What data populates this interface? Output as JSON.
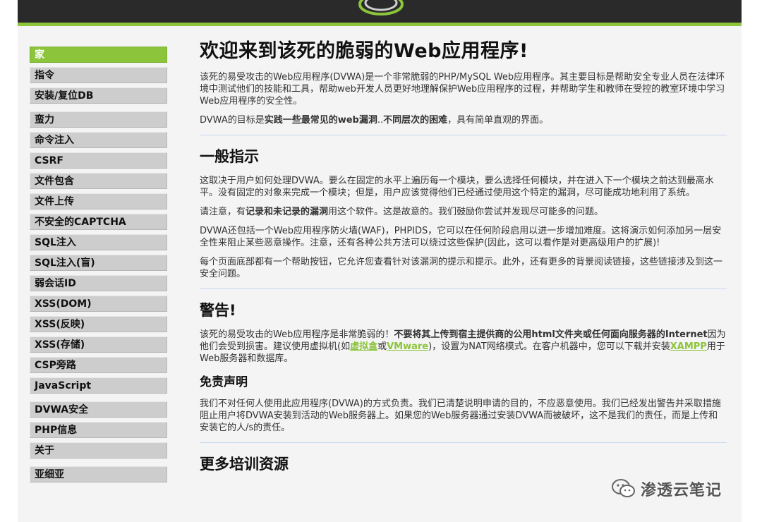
{
  "colors": {
    "accent": "#8cc43c",
    "header_bg": "#2a2a2a",
    "page_bg": "#f4f4f4"
  },
  "menu": {
    "groups": [
      [
        {
          "label": "家",
          "selected": true
        },
        {
          "label": "指令"
        },
        {
          "label": "安装/复位DB"
        }
      ],
      [
        {
          "label": "蛮力"
        },
        {
          "label": "命令注入"
        },
        {
          "label": "CSRF"
        },
        {
          "label": "文件包含"
        },
        {
          "label": "文件上传"
        },
        {
          "label": "不安全的CAPTCHA"
        },
        {
          "label": "SQL注入"
        },
        {
          "label": "SQL注入(盲)"
        },
        {
          "label": "弱会话ID"
        },
        {
          "label": "XSS(DOM)"
        },
        {
          "label": "XSS(反映)"
        },
        {
          "label": "XSS(存储)"
        },
        {
          "label": "CSP旁路"
        },
        {
          "label": "JavaScript"
        }
      ],
      [
        {
          "label": "DVWA安全"
        },
        {
          "label": "PHP信息"
        },
        {
          "label": "关于"
        }
      ],
      [
        {
          "label": "亚细亚"
        }
      ]
    ]
  },
  "main": {
    "title": "欢迎来到该死的脆弱的Web应用程序!",
    "intro_p1": "该死的易受攻击的Web应用程序(DVWA)是一个非常脆弱的PHP/MySQL Web应用程序。其主要目标是帮助安全专业人员在法律环境中测试他们的技能和工具，帮助web开发人员更好地理解保护Web应用程序的过程，并帮助学生和教师在受控的教室环境中学习Web应用程序的安全性。",
    "intro_p2": {
      "pre": "DVWA的目标是",
      "b1": "实践一些最常见的web漏洞",
      "mid": "..",
      "b2": "不同层次的困难",
      "post": "，具有简单直观的界面。"
    },
    "general": {
      "heading": "一般指示",
      "p1": "这取决于用户如何处理DVWA。要么在固定的水平上遍历每一个模块，要么选择任何模块，并在进入下一个模块之前达到最高水平。没有固定的对象来完成一个模块；但是，用户应该觉得他们已经通过使用这个特定的漏洞，尽可能成功地利用了系统。",
      "p2": {
        "pre": "请注意，有",
        "bold": "记录和未记录的漏洞",
        "post": "用这个软件。这是故意的。我们鼓励你尝试并发现尽可能多的问题。"
      },
      "p3": "DVWA还包括一个Web应用程序防火墙(WAF)，PHPIDS，它可以在任何阶段启用以进一步增加难度。这将演示如何添加另一层安全性来阻止某些恶意操作。注意，还有各种公共方法可以绕过这些保护(因此，这可以看作是对更高级用户的扩展)!",
      "p4": "每个页面底部都有一个帮助按钮，它允许您查看针对该漏洞的提示和提示。此外，还有更多的背景阅读链接，这些链接涉及到这一安全问题。"
    },
    "warning": {
      "heading": "警告!",
      "pre": "该死的易受攻击的Web应用程序是非常脆弱的！",
      "bold": "不要将其上传到宿主提供商的公用html文件夹或任何面向服务器的Internet",
      "mid1": "因为他们会受到损害。建议使用虚拟机(如",
      "link1": "虚拟盒",
      "mid2": "或",
      "link2": "VMware",
      "mid3": ")，设置为NAT网络模式。在客户机器中，您可以下载并安装",
      "link3": "XAMPP",
      "post": "用于Web服务器和数据库。"
    },
    "disclaimer": {
      "heading": "免责声明",
      "p": "我们不对任何人使用此应用程序(DVWA)的方式负责。我们已清楚说明申请的目的，不应恶意使用。我们已经发出警告并采取措施阻止用户将DVWA安装到活动的Web服务器上。如果您的Web服务器通过安装DVWA而被破坏，这不是我们的责任，而是上传和安装它的人/s的责任。"
    },
    "more_heading": "更多培训资源"
  },
  "watermark": {
    "text": "渗透云笔记",
    "icon": "wechat-icon"
  }
}
